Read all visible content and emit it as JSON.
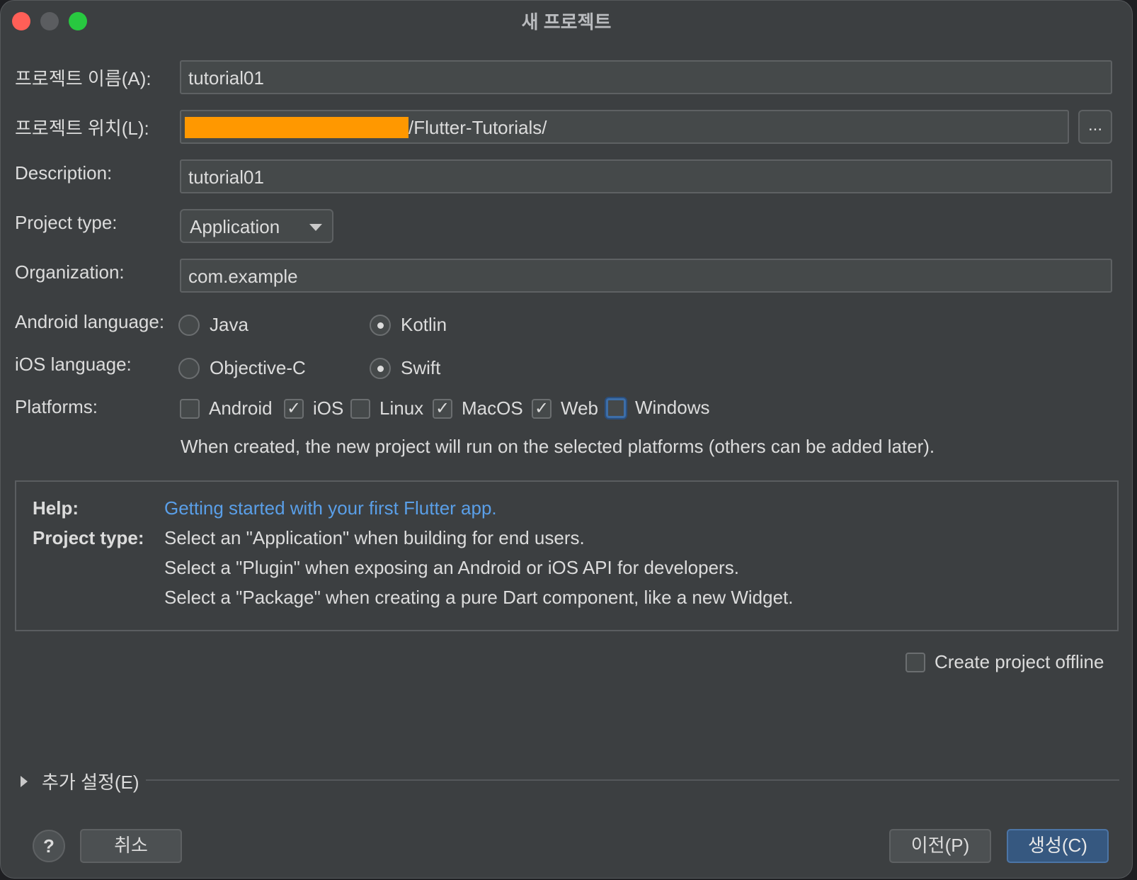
{
  "window": {
    "title": "새 프로젝트"
  },
  "form": {
    "name_label": "프로젝트 이름(A):",
    "name_value": "tutorial01",
    "location_label": "프로젝트 위치(L):",
    "location_suffix": "/Flutter-Tutorials/",
    "browse_label": "...",
    "description_label": "Description:",
    "description_value": "tutorial01",
    "project_type_label": "Project type:",
    "project_type_value": "Application",
    "organization_label": "Organization:",
    "organization_value": "com.example",
    "android_language_label": "Android language:",
    "android_options": [
      {
        "label": "Java",
        "selected": false
      },
      {
        "label": "Kotlin",
        "selected": true
      }
    ],
    "ios_language_label": "iOS language:",
    "ios_options": [
      {
        "label": "Objective-C",
        "selected": false
      },
      {
        "label": "Swift",
        "selected": true
      }
    ],
    "platforms_label": "Platforms:",
    "platforms": [
      {
        "label": "Android",
        "checked": false
      },
      {
        "label": "iOS",
        "checked": true
      },
      {
        "label": "Linux",
        "checked": false
      },
      {
        "label": "MacOS",
        "checked": true
      },
      {
        "label": "Web",
        "checked": true
      },
      {
        "label": "Windows",
        "checked": false,
        "focused": true
      }
    ],
    "platforms_note": "When created, the new project will run on the selected platforms (others can be added later)."
  },
  "help": {
    "help_label": "Help:",
    "help_link": "Getting started with your first Flutter app.",
    "project_type_label": "Project type:",
    "lines": [
      "Select an \"Application\" when building for end users.",
      "Select a \"Plugin\" when exposing an Android or iOS API for developers.",
      "Select a \"Package\" when creating a pure Dart component, like a new Widget."
    ]
  },
  "offline": {
    "label": "Create project offline",
    "checked": false
  },
  "advanced": {
    "label": "추가 설정(E)"
  },
  "buttons": {
    "help": "?",
    "cancel": "취소",
    "previous": "이전(P)",
    "create": "생성(C)"
  },
  "colors": {
    "window_bg": "#3c3f41",
    "field_bg": "#45494a",
    "link": "#5a9fe8",
    "primary_button": "#365880",
    "redaction": "#ff9800"
  },
  "icons": {
    "close": "close-icon",
    "minimize": "minimize-icon",
    "zoom": "zoom-icon",
    "dropdown": "chevron-down-icon",
    "expand": "triangle-right-icon",
    "help": "question-icon"
  }
}
